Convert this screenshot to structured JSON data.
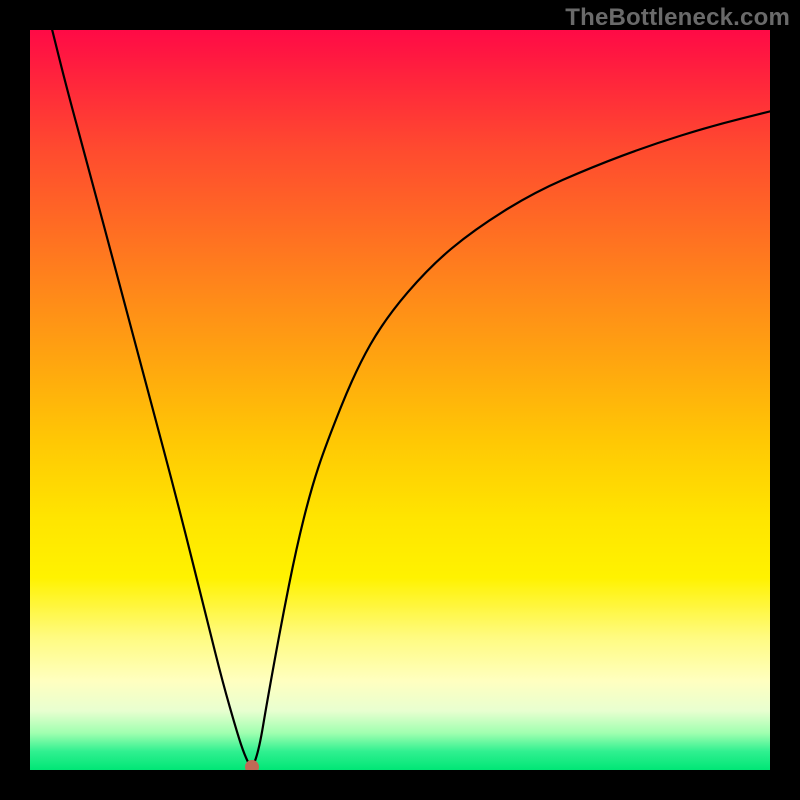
{
  "watermark": "TheBottleneck.com",
  "chart_data": {
    "type": "line",
    "title": "",
    "xlabel": "",
    "ylabel": "",
    "xlim": [
      0,
      100
    ],
    "ylim": [
      0,
      100
    ],
    "grid": false,
    "legend": false,
    "series": [
      {
        "name": "curve",
        "x": [
          3,
          5,
          8,
          12,
          16,
          20,
          24,
          26,
          28,
          29,
          30,
          31,
          32,
          34,
          36,
          38,
          40,
          44,
          48,
          54,
          60,
          68,
          76,
          84,
          92,
          100
        ],
        "y": [
          100,
          92,
          81,
          66,
          51,
          36,
          20,
          12,
          5,
          2,
          0,
          3,
          9,
          20,
          30,
          38,
          44,
          54,
          61,
          68,
          73,
          78,
          81.5,
          84.5,
          87,
          89
        ]
      }
    ],
    "minimum_marker": {
      "x": 30,
      "y": 0
    }
  },
  "colors": {
    "curve": "#000000",
    "dot": "#c06a56",
    "gradient_top": "#ff0a46",
    "gradient_bottom": "#00e676",
    "background": "#000000",
    "watermark": "#6a6a6a"
  }
}
